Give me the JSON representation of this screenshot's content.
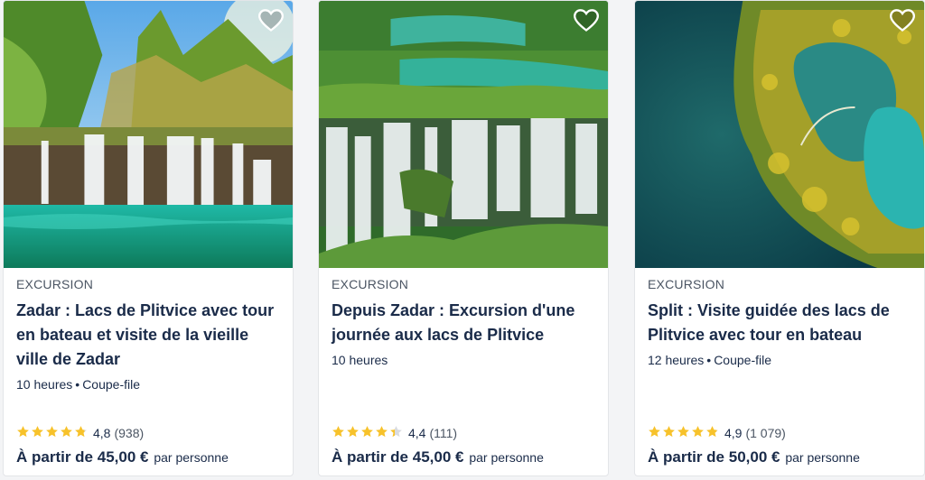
{
  "cards": [
    {
      "category": "EXCURSION",
      "title": "Zadar : Lacs de Plitvice avec tour en bateau et visite de la vieille ville de Zadar",
      "meta": [
        "10 heures",
        "Coupe-file"
      ],
      "rating": "4,8",
      "rating_value": 4.8,
      "reviews": "(938)",
      "price_from": "À partir de 45,00 €",
      "price_unit": "par personne",
      "image_icon": "waterfall-lake-photo"
    },
    {
      "category": "EXCURSION",
      "title": "Depuis Zadar : Excursion d'une journée aux lacs de Plitvice",
      "meta": [
        "10 heures"
      ],
      "rating": "4,4",
      "rating_value": 4.4,
      "reviews": "(111)",
      "price_from": "À partir de 45,00 €",
      "price_unit": "par personne",
      "image_icon": "cascading-waterfalls-photo"
    },
    {
      "category": "EXCURSION",
      "title": "Split : Visite guidée des lacs de Plitvice avec tour en bateau",
      "meta": [
        "12 heures",
        "Coupe-file"
      ],
      "rating": "4,9",
      "rating_value": 4.9,
      "reviews": "(1 079)",
      "price_from": "À partir de 50,00 €",
      "price_unit": "par personne",
      "image_icon": "aerial-lakes-photo"
    }
  ],
  "colors": {
    "star": "#f7c22b",
    "text": "#1a2b49",
    "muted": "#4b5563"
  },
  "icons": {
    "wishlist": "heart-icon",
    "rating": "star-icon"
  }
}
